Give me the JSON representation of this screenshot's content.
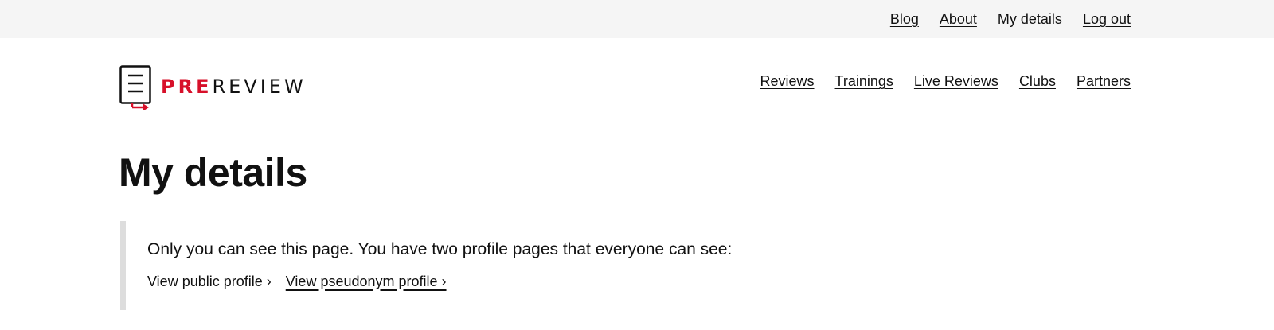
{
  "top_nav": {
    "items": [
      {
        "label": "Blog",
        "current": false
      },
      {
        "label": "About",
        "current": false
      },
      {
        "label": "My details",
        "current": true
      },
      {
        "label": "Log out",
        "current": false
      }
    ]
  },
  "logo": {
    "pre": "PRE",
    "review": "REVIEW",
    "icon": "document-arrow-icon",
    "accent_color": "#d7102a"
  },
  "main_nav": {
    "items": [
      {
        "label": "Reviews"
      },
      {
        "label": "Trainings"
      },
      {
        "label": "Live Reviews"
      },
      {
        "label": "Clubs"
      },
      {
        "label": "Partners"
      }
    ]
  },
  "page": {
    "title": "My details"
  },
  "notice": {
    "text": "Only you can see this page. You have two profile pages that everyone can see:",
    "links": [
      {
        "label": "View public profile ›"
      },
      {
        "label": "View pseudonym profile ›"
      }
    ]
  }
}
